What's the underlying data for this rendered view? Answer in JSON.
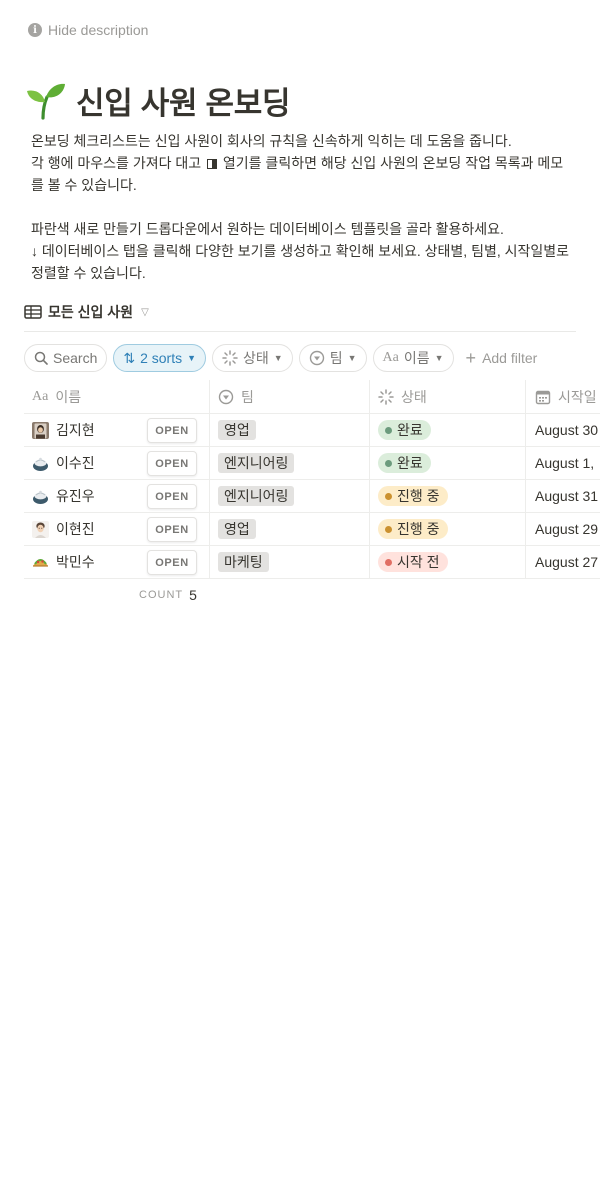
{
  "hide_description": "Hide description",
  "page": {
    "title": "신입 사원 온보딩",
    "description": [
      "온보딩 체크리스트는 신입 사원이 회사의 규칙을 신속하게 익히는 데 도움을 줍니다.",
      "각 행에 마우스를 가져다 대고",
      "열기를 클릭하면 해당 신입 사원의 온보딩 작업 목록과 메모를 볼 수 있습니다.",
      "파란색 새로 만들기 드롭다운에서 원하는 데이터베이스 템플릿을 골라 활용하세요.",
      "↓ 데이터베이스 탭을 클릭해 다양한 보기를 생성하고 확인해 보세요. 상태별, 팀별, 시작일별로 정렬할 수 있습니다."
    ]
  },
  "view": {
    "name": "모든 신입 사원"
  },
  "filters": {
    "search": "Search",
    "sorts": "2 sorts",
    "status": "상태",
    "team": "팀",
    "name": "이름",
    "add_filter": "Add filter"
  },
  "columns": {
    "name": "이름",
    "team": "팀",
    "status": "상태",
    "start": "시작일"
  },
  "open_label": "OPEN",
  "rows": [
    {
      "name": "김지현",
      "team": "영업",
      "status": "완료",
      "start": "August 30",
      "avatar": "person-photo-icon",
      "status_color": "#dbeddb",
      "dot_color": "#6c9b7d"
    },
    {
      "name": "이수진",
      "team": "엔지니어링",
      "status": "완료",
      "start": "August 1,",
      "avatar": "dumpling-icon",
      "status_color": "#dbeddb",
      "dot_color": "#6c9b7d"
    },
    {
      "name": "유진우",
      "team": "엔지니어링",
      "status": "진행 중",
      "start": "August 31",
      "avatar": "dumpling-icon",
      "status_color": "#fdecc8",
      "dot_color": "#cb912f"
    },
    {
      "name": "이현진",
      "team": "영업",
      "status": "진행 중",
      "start": "August 29",
      "avatar": "person-face-icon",
      "status_color": "#fdecc8",
      "dot_color": "#cb912f"
    },
    {
      "name": "박민수",
      "team": "마케팅",
      "status": "시작 전",
      "start": "August 27",
      "avatar": "taco-icon",
      "status_color": "#ffe2dd",
      "dot_color": "#e16f64"
    }
  ],
  "count": {
    "label": "COUNT",
    "value": "5"
  }
}
